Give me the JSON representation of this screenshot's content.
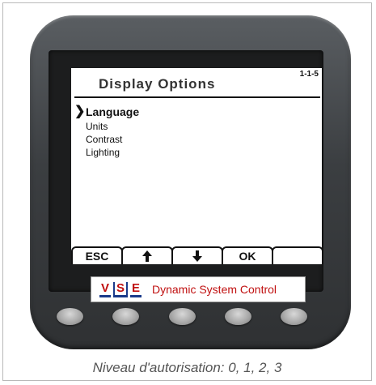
{
  "screen": {
    "title": "Display Options",
    "code": "1-1-5",
    "menu": {
      "selector": "❯",
      "items": [
        "Language",
        "Units",
        "Contrast",
        "Lighting"
      ],
      "selected_index": 0
    },
    "softkeys": {
      "esc": "ESC",
      "up_icon": "arrow-up-icon",
      "down_icon": "arrow-down-icon",
      "ok": "OK",
      "empty": ""
    }
  },
  "brand": {
    "logo_letters": [
      "V",
      "S",
      "E"
    ],
    "text": "Dynamic System Control",
    "colors": {
      "red": "#c01010",
      "blue": "#1a3a8a"
    }
  },
  "caption": "Niveau d'autorisation: 0, 1, 2, 3"
}
